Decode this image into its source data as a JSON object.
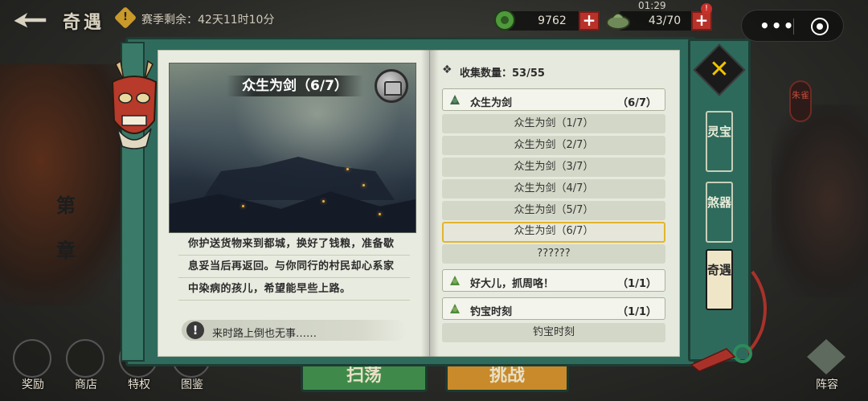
{
  "topbar": {
    "title": "奇遇",
    "season_icon_glyph": "!",
    "season_text": "赛季剩余：42天11时10分",
    "jade_value": "9762",
    "energy_value": "43/70",
    "energy_timer": "01:29",
    "alert_badge": "!",
    "plus_symbol": "+",
    "more_symbol": "•••"
  },
  "side": {
    "chapter_text": "第 章",
    "zhuque_badge": "朱雀"
  },
  "bottom_nav": {
    "items": [
      {
        "label": "奖励"
      },
      {
        "label": "商店"
      },
      {
        "label": "特权"
      },
      {
        "label": "图鉴"
      }
    ],
    "lineup_label": "阵容",
    "sweep_label": "扫荡",
    "challenge_label": "挑战"
  },
  "story": {
    "title": "众生为剑（6/7）",
    "desc_lines": [
      "你护送货物来到都城，换好了钱粮，准备歇",
      "息妥当后再返回。与你同行的村民却心系家",
      "中染病的孩儿，希望能早些上路。"
    ],
    "hint_icon": "!",
    "hint_text": "来时路上倒也无事……"
  },
  "collection": {
    "icon": "❖",
    "label": "收集数量：53/55",
    "groups": [
      {
        "name": "众生为剑",
        "count": "（6/7）"
      },
      {
        "name": "好大儿，抓周咯！",
        "count": "（1/1）"
      },
      {
        "name": "钓宝时刻",
        "count": "（1/1）"
      }
    ],
    "sub_items": [
      "众生为剑（1/7）",
      "众生为剑（2/7）",
      "众生为剑（3/7）",
      "众生为剑（4/7）",
      "众生为剑（5/7）",
      "众生为剑（6/7）",
      "??????",
      "钓宝时刻"
    ]
  },
  "tabs": {
    "close_symbol": "✕",
    "items": [
      {
        "label": "灵宝"
      },
      {
        "label": "煞器"
      },
      {
        "label": "奇遇"
      }
    ]
  },
  "colors": {
    "book_green": "#2f6b5d",
    "page": "#e8ebdf",
    "selected_border": "#e2b52e",
    "plus_red": "#b8322a",
    "close_gold": "#f0c400"
  }
}
